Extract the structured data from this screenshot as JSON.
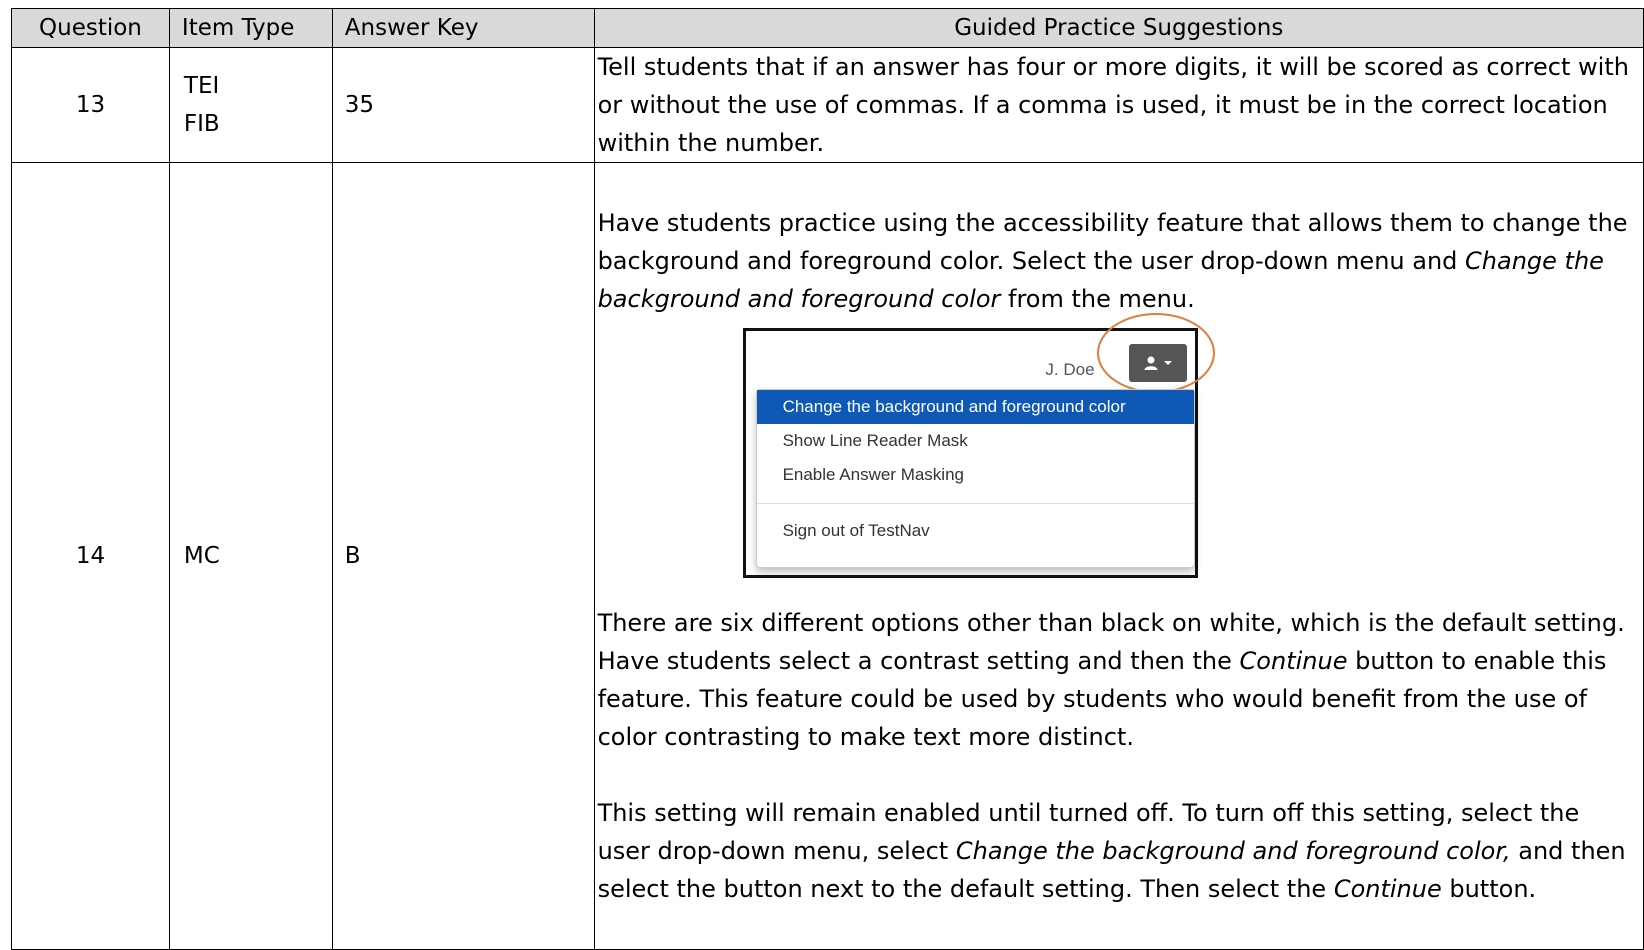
{
  "headers": {
    "question": "Question",
    "item_type": "Item Type",
    "answer_key": "Answer Key",
    "guided": "Guided Practice Suggestions"
  },
  "rows": [
    {
      "question": "13",
      "item_type_1": "TEI",
      "item_type_2": "FIB",
      "answer_key": "35",
      "guided": "Tell students that if an answer has four or more digits, it will be scored as correct with or without the use of commas. If a comma is used, it must be in the correct location within the number."
    },
    {
      "question": "14",
      "item_type": "MC",
      "answer_key": "B",
      "guided_p1_a": "Have students practice using the accessibility feature that allows them to change the background and foreground color.  Select the user drop-down menu and ",
      "guided_p1_em": "Change the background and foreground color",
      "guided_p1_b": " from the menu.",
      "guided_p2_a": "There are six different options other than black on white, which is the default setting.  Have students select a contrast setting and then the ",
      "guided_p2_em": "Continue",
      "guided_p2_b": " button to enable this feature. This feature could be used by students who would benefit from the use of color contrasting to make text more distinct.",
      "guided_p3_a": "This setting will remain enabled until turned off.  To turn off this setting, select the user drop-down menu, select ",
      "guided_p3_em1": "Change the background and foreground color,",
      "guided_p3_b": " and then select the button next to the default setting. Then select the ",
      "guided_p3_em2": "Continue",
      "guided_p3_c": " button."
    }
  ],
  "screenshot": {
    "user_name": "J. Doe",
    "menu_items": [
      "Change the background and foreground color",
      "Show Line Reader Mask",
      "Enable Answer Masking",
      "Sign out of TestNav"
    ],
    "highlight_color": "#e07b39",
    "active_color": "#0e59b5"
  }
}
